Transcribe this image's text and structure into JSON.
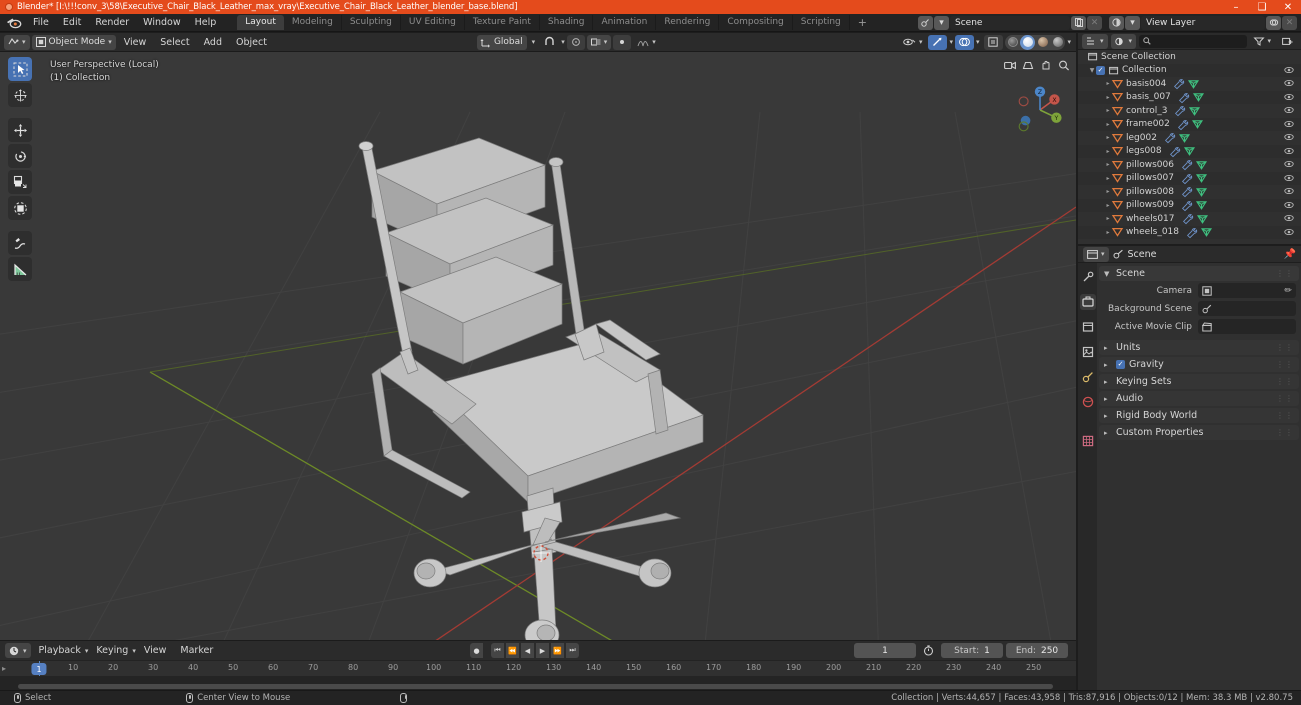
{
  "window": {
    "title": "Blender* [I:\\!!!conv_3\\58\\Executive_Chair_Black_Leather_max_vray\\Executive_Chair_Black_Leather_blender_base.blend]",
    "minimize": "–",
    "maximize": "❑",
    "close": "✕"
  },
  "menubar": {
    "items": [
      "File",
      "Edit",
      "Render",
      "Window",
      "Help"
    ],
    "workspaces": [
      {
        "label": "Layout",
        "active": true
      },
      {
        "label": "Modeling",
        "active": false
      },
      {
        "label": "Sculpting",
        "active": false
      },
      {
        "label": "UV Editing",
        "active": false
      },
      {
        "label": "Texture Paint",
        "active": false
      },
      {
        "label": "Shading",
        "active": false
      },
      {
        "label": "Animation",
        "active": false
      },
      {
        "label": "Rendering",
        "active": false
      },
      {
        "label": "Compositing",
        "active": false
      },
      {
        "label": "Scripting",
        "active": false
      }
    ],
    "add_workspace": "+",
    "scene_name": "Scene",
    "view_layer_name": "View Layer"
  },
  "viewport_header": {
    "mode": "Object Mode",
    "menus": [
      "View",
      "Select",
      "Add",
      "Object"
    ],
    "transform_orientation": "Global",
    "snap_label": "",
    "proportional_label": ""
  },
  "viewport": {
    "perspective_line1": "User Perspective (Local)",
    "perspective_line2": "(1) Collection",
    "axis_x": "X",
    "axis_y": "Y",
    "axis_z": "Z"
  },
  "outliner": {
    "search_placeholder": "",
    "scene_collection": "Scene Collection",
    "collection": "Collection",
    "objects": [
      "basis004",
      "basis_007",
      "control_3",
      "frame002",
      "leg002",
      "legs008",
      "pillows006",
      "pillows007",
      "pillows008",
      "pillows009",
      "wheels017",
      "wheels_018"
    ]
  },
  "properties": {
    "breadcrumb": "Scene",
    "panels": [
      {
        "label": "Scene",
        "open": true
      },
      {
        "label": "Units",
        "open": false
      },
      {
        "label": "Gravity",
        "open": false,
        "checkbox": true
      },
      {
        "label": "Keying Sets",
        "open": false
      },
      {
        "label": "Audio",
        "open": false
      },
      {
        "label": "Rigid Body World",
        "open": false
      },
      {
        "label": "Custom Properties",
        "open": false
      }
    ],
    "fields": [
      {
        "label": "Camera",
        "value": ""
      },
      {
        "label": "Background Scene",
        "value": ""
      },
      {
        "label": "Active Movie Clip",
        "value": ""
      }
    ]
  },
  "timeline": {
    "editor_menus": [
      "Playback",
      "Keying",
      "View",
      "Marker"
    ],
    "current_frame": "1",
    "start_label": "Start:",
    "start_value": "1",
    "end_label": "End:",
    "end_value": "250",
    "ticks": [
      "10",
      "20",
      "30",
      "40",
      "50",
      "60",
      "70",
      "80",
      "90",
      "100",
      "110",
      "120",
      "130",
      "140",
      "150",
      "160",
      "170",
      "180",
      "190",
      "200",
      "210",
      "220",
      "230",
      "240",
      "250"
    ],
    "playhead_frame": "1"
  },
  "statusbar": {
    "left_action": "Select",
    "middle_action": "Center View to Mouse",
    "stats": "Collection | Verts:44,657 | Faces:43,958 | Tris:87,916 | Objects:0/12 | Mem: 38.3 MB | v2.80.75"
  },
  "colors": {
    "title_bar": "#e44b1c",
    "accent_blue": "#4772b3",
    "axis_x_red": "#c0392b",
    "axis_y_green": "#7a9a28",
    "outliner_object_orange": "#e07a3c",
    "mesh_green": "#3fbf7f"
  }
}
